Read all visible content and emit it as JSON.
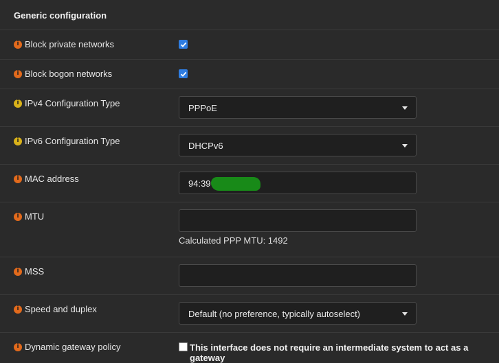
{
  "section_title": "Generic configuration",
  "fields": {
    "block_private": {
      "label": "Block private networks",
      "checked": true
    },
    "block_bogon": {
      "label": "Block bogon networks",
      "checked": true
    },
    "ipv4_type": {
      "label": "IPv4 Configuration Type",
      "value": "PPPoE"
    },
    "ipv6_type": {
      "label": "IPv6 Configuration Type",
      "value": "DHCPv6"
    },
    "mac": {
      "label": "MAC address",
      "value": "94:39"
    },
    "mtu": {
      "label": "MTU",
      "value": "",
      "helper": "Calculated PPP MTU: 1492"
    },
    "mss": {
      "label": "MSS",
      "value": ""
    },
    "speed": {
      "label": "Speed and duplex",
      "value": "Default (no preference, typically autoselect)"
    },
    "gateway_policy": {
      "label": "Dynamic gateway policy",
      "checked": false,
      "text": "This interface does not require an intermediate system to act as a gateway"
    }
  },
  "colors": {
    "background": "#2a2a2a",
    "info_icon_orange": "#e26a1c",
    "info_icon_yellow": "#d9b21a",
    "checkbox_checked": "#2f7de1",
    "redaction": "#188a18"
  },
  "icons": {
    "info": "info-circle",
    "dropdown": "caret-down",
    "check": "checkmark"
  }
}
